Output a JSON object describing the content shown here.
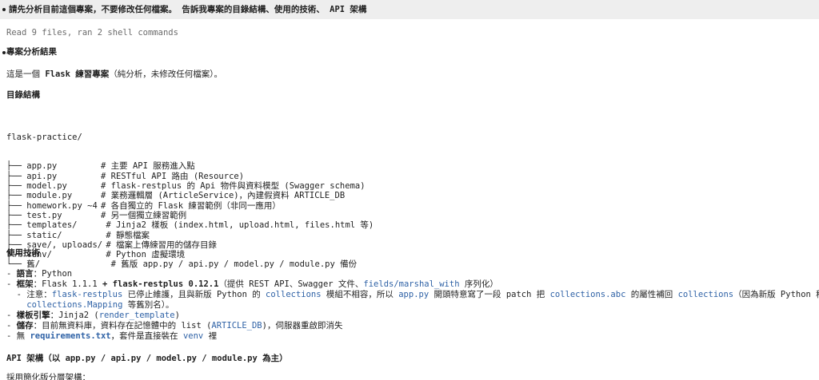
{
  "prompt": "請先分析目前這個專案，不要修改任何檔案。 告訴我專案的目錄結構、使用的技術、 API 架構",
  "meta": "Read 9 files, ran 2 shell commands",
  "result_heading": "專案分析結果",
  "intro": {
    "prefix": "這是一個 ",
    "bold": "Flask 練習專案",
    "suffix": "（純分析，未修改任何檔案）。"
  },
  "tree_heading": "目錄結構",
  "tree_root": "flask-practice/",
  "tree": [
    {
      "name": "├── app.py",
      "comment": "# 主要 API 服務進入點"
    },
    {
      "name": "├── api.py",
      "comment": "# RESTful API 路由 (Resource)"
    },
    {
      "name": "├── model.py",
      "comment": "# flask-restplus 的 Api 物件與資料模型 (Swagger schema)"
    },
    {
      "name": "├── module.py",
      "comment": "# 業務邏輯層 (ArticleService)，內建假資料 ARTICLE_DB"
    },
    {
      "name": "├── homework.py ~4",
      "comment": "# 各自獨立的 Flask 練習範例（非同一應用）"
    },
    {
      "name": "├── test.py",
      "comment": "# 另一個獨立練習範例"
    },
    {
      "name": "├── templates/",
      "comment": " # Jinja2 樣板 (index.html, upload.html, files.html 等)"
    },
    {
      "name": "├── static/",
      "comment": " # 靜態檔案"
    },
    {
      "name": "├── save/, uploads/",
      "comment": " # 檔案上傳練習用的儲存目錄"
    },
    {
      "name": "├── venv/",
      "comment": " # Python 虛擬環境"
    },
    {
      "name": "└── 舊/",
      "comment": "  # 舊版 app.py / api.py / model.py / module.py 備份"
    }
  ],
  "tech_heading": "使用技術",
  "tech": {
    "lang_label": "語言",
    "lang_value": "Python",
    "framework_label": "框架",
    "framework_sep": "：",
    "framework_flask": "Flask 1.1.1",
    "framework_plus": " + ",
    "framework_restplus": "flask-restplus 0.12.1",
    "framework_desc_a": "（提供 REST API、Swagger 文件、",
    "framework_code": "fields/marshal_with",
    "framework_desc_b": " 序列化）",
    "note_label": "注意",
    "note_code1": "flask-restplus",
    "note_text1": " 已停止維護，且與新版 Python 的 ",
    "note_code2": "collections",
    "note_text2": " 模組不相容，所以 ",
    "note_code3": "app.py",
    "note_text3": " 開頭特意寫了一段 patch 把 ",
    "note_code4": "collections.abc",
    "note_text4": " 的屬性補回 ",
    "note_code5": "collections",
    "note_text5": "（因為新版 Python 移除了",
    "note_code6": "collections.Mapping",
    "note_text6": " 等舊別名）。",
    "template_label": "樣板引擎",
    "template_value": "Jinja2 (",
    "template_code": "render_template",
    "template_end": ")",
    "storage_label": "儲存",
    "storage_text_a": "目前無資料庫，資料存在記憶體中的 list (",
    "storage_code": "ARTICLE_DB",
    "storage_text_b": ")，伺服器重啟即消失",
    "req_prefix": "無 ",
    "req_code": "requirements.txt",
    "req_text_a": "，套件是直接裝在 ",
    "req_code2": "venv",
    "req_text_b": " 裡"
  },
  "api_heading": "API 架構（以 app.py / api.py / model.py / module.py 為主）",
  "api_intro": "採用簡化版分層架構："
}
